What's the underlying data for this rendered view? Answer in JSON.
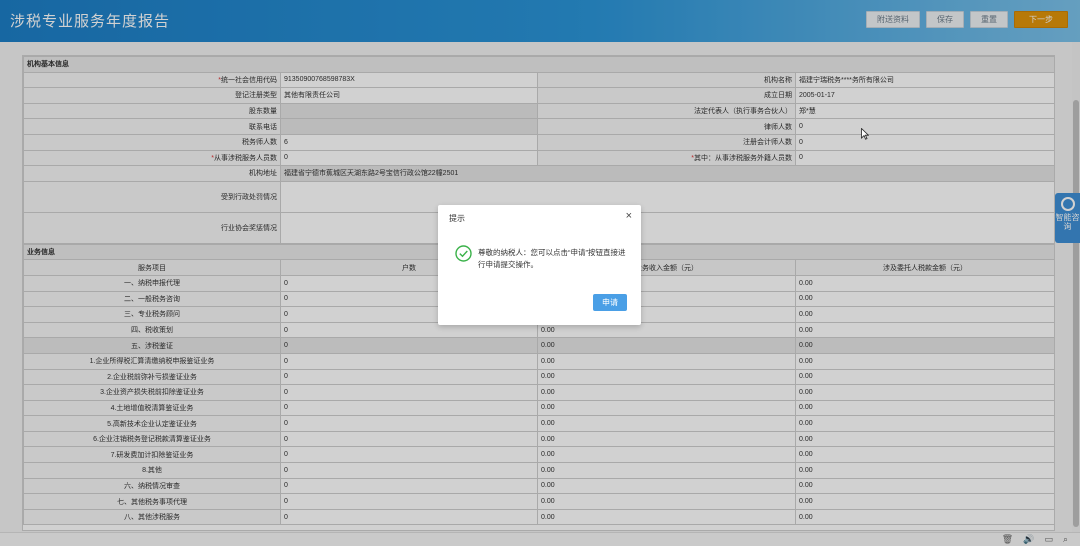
{
  "header": {
    "title": "涉税专业服务年度报告",
    "buttons": [
      "附送资料",
      "保存",
      "重置",
      "下一步"
    ]
  },
  "basic": {
    "section_title": "机构基本信息",
    "rows": [
      {
        "l1": "统一社会信用代码",
        "r1": true,
        "v1": "91350900768598783X",
        "l2": "机构名称",
        "v2": "福建宁瑞税务****务所有限公司"
      },
      {
        "l1": "登记注册类型",
        "v1": "其他有限责任公司",
        "l2": "成立日期",
        "v2": "2005-01-17"
      },
      {
        "l1": "股东数量",
        "v1": "",
        "l2": "法定代表人（执行事务合伙人）",
        "v2": "郑*慧"
      },
      {
        "l1": "联系电话",
        "v1": "",
        "l2": "律师人数",
        "v2": "0"
      },
      {
        "l1": "税务师人数",
        "v1": "6",
        "l2": "注册会计师人数",
        "v2": "0"
      },
      {
        "l1": "从事涉税服务人员数",
        "r1": true,
        "v1": "0",
        "l2": "其中：从事涉税服务外籍人员数",
        "r2": true,
        "v2": "0"
      }
    ],
    "address_label": "机构地址",
    "address_value": "福建省宁德市蕉城区天湖东路2号宝信行政公馆22幢2501",
    "penalty_label": "受到行政处罚情况",
    "award_label": "行业协会奖惩情况"
  },
  "biz": {
    "section_title": "业务信息",
    "columns": [
      "服务项目",
      "户数",
      "业务收入金额（元）",
      "涉及委托人税款金额（元）"
    ],
    "rows": [
      {
        "name": "一、纳税申报代理",
        "c2": "0",
        "c3": "",
        "c4": "0.00"
      },
      {
        "name": "二、一般税务咨询",
        "c2": "0",
        "c3": "",
        "c4": "0.00"
      },
      {
        "name": "三、专业税务顾问",
        "c2": "0",
        "c3": "",
        "c4": "0.00"
      },
      {
        "name": "四、税收策划",
        "c2": "0",
        "c3": "0.00",
        "c4": "0.00"
      },
      {
        "name": "五、涉税鉴证",
        "c2": "0",
        "c3": "0.00",
        "c4": "0.00",
        "hl": true
      },
      {
        "name": "1.企业所得税汇算清缴纳税申报鉴证业务",
        "c2": "0",
        "c3": "0.00",
        "c4": "0.00"
      },
      {
        "name": "2.企业税前弥补亏损鉴证业务",
        "c2": "0",
        "c3": "0.00",
        "c4": "0.00"
      },
      {
        "name": "3.企业资产损失税前扣除鉴证业务",
        "c2": "0",
        "c3": "0.00",
        "c4": "0.00"
      },
      {
        "name": "4.土地增值税清算鉴证业务",
        "c2": "0",
        "c3": "0.00",
        "c4": "0.00"
      },
      {
        "name": "5.高新技术企业认定鉴证业务",
        "c2": "0",
        "c3": "0.00",
        "c4": "0.00"
      },
      {
        "name": "6.企业注销税务登记税款清算鉴证业务",
        "c2": "0",
        "c3": "0.00",
        "c4": "0.00"
      },
      {
        "name": "7.研发费加计扣除鉴证业务",
        "c2": "0",
        "c3": "0.00",
        "c4": "0.00"
      },
      {
        "name": "8.其他",
        "c2": "0",
        "c3": "0.00",
        "c4": "0.00"
      },
      {
        "name": "六、纳税情况审查",
        "c2": "0",
        "c3": "0.00",
        "c4": "0.00"
      },
      {
        "name": "七、其他税务事项代理",
        "c2": "0",
        "c3": "0.00",
        "c4": "0.00"
      },
      {
        "name": "八、其他涉税服务",
        "c2": "0",
        "c3": "0.00",
        "c4": "0.00"
      }
    ]
  },
  "side_widget": {
    "label": "智能咨询"
  },
  "dialog": {
    "title": "提示",
    "close": "×",
    "message": "尊敬的纳税人：您可以点击“申请”按钮直接进行申请提交操作。",
    "ok_label": "申请"
  }
}
